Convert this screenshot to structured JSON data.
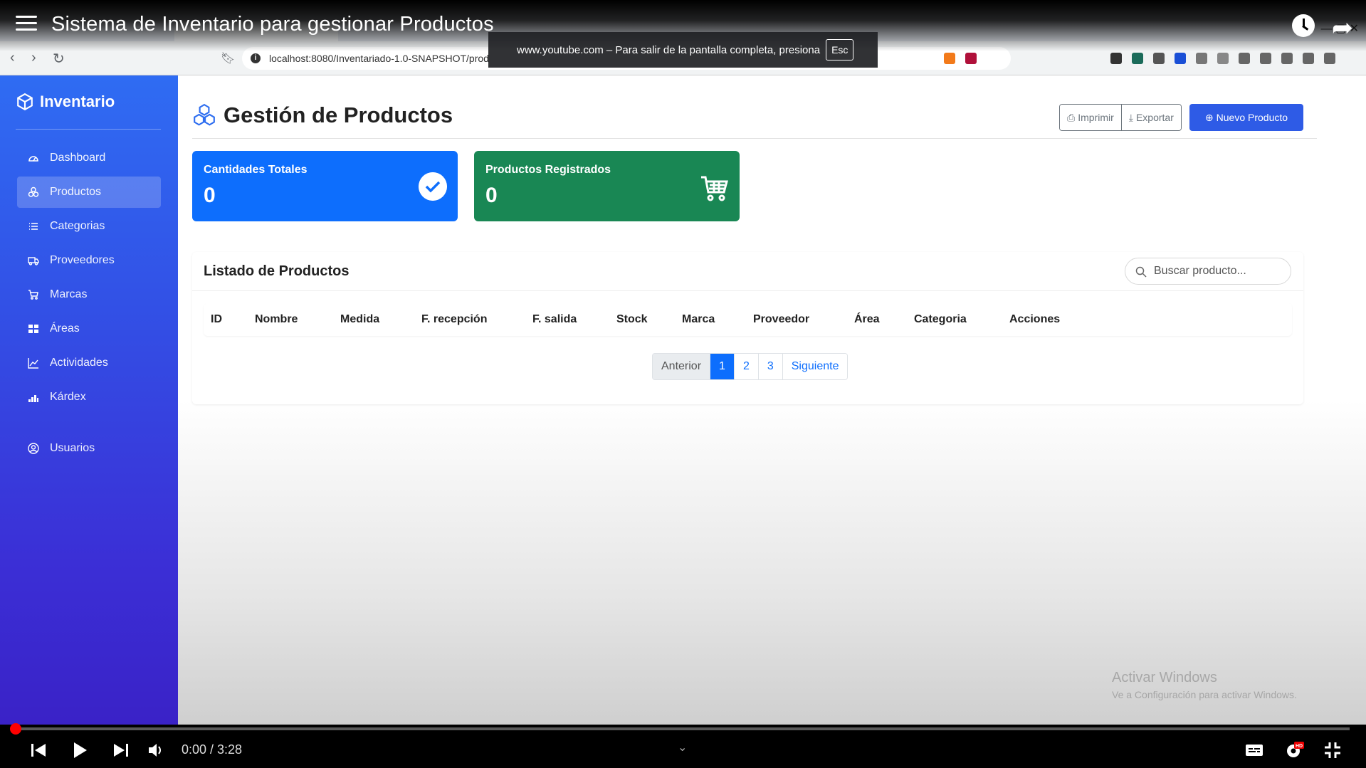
{
  "video": {
    "title": "Sistema de Inventario para gestionar Productos",
    "time": "0:00 / 3:28",
    "progress_fraction": 0.0
  },
  "browser": {
    "url": "localhost:8080/Inventariado-1.0-SNAPSHOT/prod",
    "fullscreen_notice": "www.youtube.com – Para salir de la pantalla completa, presiona",
    "fullscreen_key": "Esc"
  },
  "sidebar": {
    "brand": "Inventario",
    "items": [
      {
        "label": "Dashboard",
        "icon": "gauge-icon"
      },
      {
        "label": "Productos",
        "icon": "boxes-icon",
        "active": true
      },
      {
        "label": "Categorias",
        "icon": "list-icon"
      },
      {
        "label": "Proveedores",
        "icon": "truck-icon"
      },
      {
        "label": "Marcas",
        "icon": "cart-icon"
      },
      {
        "label": "Áreas",
        "icon": "grid-icon"
      },
      {
        "label": "Actividades",
        "icon": "chart-icon"
      },
      {
        "label": "Kárdex",
        "icon": "bars-icon"
      },
      {
        "label": "Usuarios",
        "icon": "user-icon"
      }
    ]
  },
  "header": {
    "title": "Gestión de Productos",
    "print_label": "Imprimir",
    "export_label": "Exportar",
    "new_label": "Nuevo Producto"
  },
  "cards": {
    "total": {
      "label": "Cantidades Totales",
      "value": "0"
    },
    "products": {
      "label": "Productos Registrados",
      "value": "0"
    }
  },
  "list": {
    "title": "Listado de Productos",
    "search_placeholder": "Buscar producto...",
    "columns": [
      "ID",
      "Nombre",
      "Medida",
      "F. recepción",
      "F. salida",
      "Stock",
      "Marca",
      "Proveedor",
      "Área",
      "Categoria",
      "Acciones"
    ],
    "rows": []
  },
  "pagination": {
    "prev": "Anterior",
    "pages": [
      "1",
      "2",
      "3"
    ],
    "active_page": "1",
    "next": "Siguiente"
  },
  "watermark": {
    "title": "Activar Windows",
    "subtitle": "Ve a Configuración para activar Windows."
  },
  "colors": {
    "sidebar_top": "#2f6cf3",
    "sidebar_bottom": "#3a22c7",
    "primary": "#0d6efd",
    "success": "#198754",
    "new_button": "#2e5be6"
  }
}
